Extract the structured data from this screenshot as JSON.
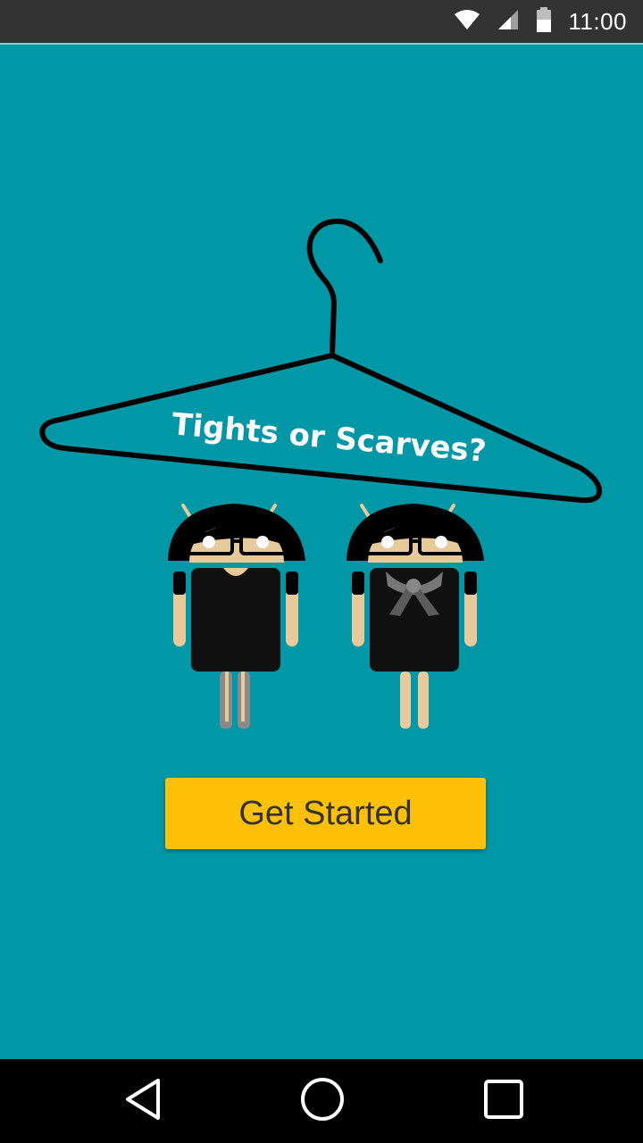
{
  "status_bar": {
    "time": "11:00",
    "icons": [
      "wifi-icon",
      "cell-signal-icon",
      "battery-icon"
    ]
  },
  "main": {
    "title": "Tights or Scarves?",
    "get_started_label": "Get Started"
  },
  "navigation": {
    "buttons": [
      "back-icon",
      "home-icon",
      "recents-icon"
    ]
  },
  "colors": {
    "background": "#0097A7",
    "button": "#FFC107",
    "status_bar": "#333333",
    "nav_bar": "#000000"
  }
}
